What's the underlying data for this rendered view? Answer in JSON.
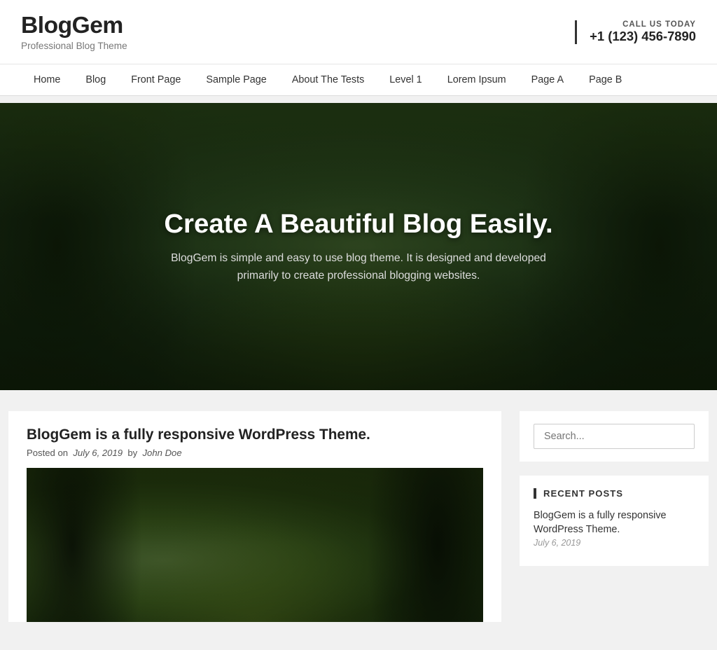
{
  "header": {
    "site_title": "BlogGem",
    "site_tagline": "Professional Blog Theme",
    "call_label": "CALL US TODAY",
    "phone": "+1 (123) 456-7890"
  },
  "nav": {
    "items": [
      {
        "label": "Home",
        "href": "#"
      },
      {
        "label": "Blog",
        "href": "#"
      },
      {
        "label": "Front Page",
        "href": "#"
      },
      {
        "label": "Sample Page",
        "href": "#"
      },
      {
        "label": "About The Tests",
        "href": "#"
      },
      {
        "label": "Level 1",
        "href": "#"
      },
      {
        "label": "Lorem Ipsum",
        "href": "#"
      },
      {
        "label": "Page A",
        "href": "#"
      },
      {
        "label": "Page B",
        "href": "#"
      }
    ]
  },
  "hero": {
    "title": "Create A Beautiful Blog Easily.",
    "description": "BlogGem is simple and easy to use blog theme. It is designed and developed primarily to create professional blogging websites."
  },
  "posts": [
    {
      "title": "BlogGem is a fully responsive WordPress Theme.",
      "meta_posted": "Posted on",
      "date": "July 6, 2019",
      "meta_by": "by",
      "author": "John Doe"
    }
  ],
  "sidebar": {
    "search_placeholder": "Search...",
    "search_label": "Search .",
    "recent_posts_title": "RECENT POSTS",
    "recent_posts": [
      {
        "title": "BlogGem is a fully responsive WordPress Theme.",
        "date": "July 6, 2019"
      }
    ]
  }
}
